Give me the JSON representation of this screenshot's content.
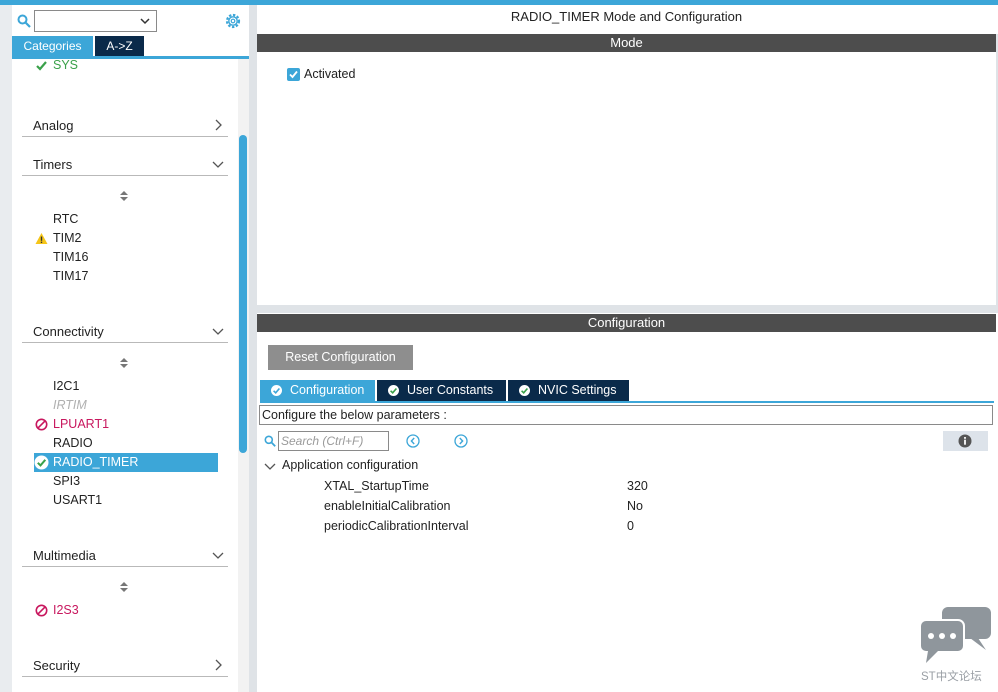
{
  "colors": {
    "accent": "#3ca6d8",
    "dark_tab": "#0a2a4a",
    "header_bar": "#4d4d4d",
    "error": "#c8175e",
    "ok": "#3aa14a",
    "warning": "#f5c518"
  },
  "left": {
    "search": {
      "value": ""
    },
    "tabs": [
      {
        "label": "Categories"
      },
      {
        "label": "A->Z"
      }
    ],
    "tree": {
      "top_item": {
        "label": "SYS",
        "status": "ok"
      },
      "categories": [
        {
          "label": "Analog",
          "expanded": false
        },
        {
          "label": "Timers",
          "expanded": true,
          "items": [
            {
              "label": "RTC"
            },
            {
              "label": "TIM2",
              "status": "warning"
            },
            {
              "label": "TIM16"
            },
            {
              "label": "TIM17"
            }
          ]
        },
        {
          "label": "Connectivity",
          "expanded": true,
          "items": [
            {
              "label": "I2C1"
            },
            {
              "label": "IRTIM",
              "status": "disabled"
            },
            {
              "label": "LPUART1",
              "status": "error"
            },
            {
              "label": "RADIO"
            },
            {
              "label": "RADIO_TIMER",
              "status": "ok",
              "selected": true
            },
            {
              "label": "SPI3"
            },
            {
              "label": "USART1"
            }
          ]
        },
        {
          "label": "Multimedia",
          "expanded": true,
          "items": [
            {
              "label": "I2S3",
              "status": "error"
            }
          ]
        },
        {
          "label": "Security",
          "expanded": false
        }
      ]
    }
  },
  "right": {
    "title": "RADIO_TIMER Mode and Configuration",
    "mode_bar": "Mode",
    "activated": {
      "label": "Activated",
      "checked": true
    },
    "config_bar": "Configuration",
    "reset_button": "Reset Configuration",
    "config_tabs": [
      {
        "label": "Configuration"
      },
      {
        "label": "User Constants"
      },
      {
        "label": "NVIC Settings"
      }
    ],
    "params_hint": "Configure the below parameters :",
    "param_search": {
      "placeholder": "Search (Ctrl+F)"
    },
    "group": {
      "label": "Application configuration",
      "expanded": true,
      "params": [
        {
          "name": "XTAL_StartupTime",
          "value": "320"
        },
        {
          "name": "enableInitialCalibration",
          "value": "No"
        },
        {
          "name": "periodicCalibrationInterval",
          "value": "0"
        }
      ]
    }
  },
  "watermark": {
    "label": "ST中文论坛",
    "icon": "chat-bubbles-icon"
  }
}
